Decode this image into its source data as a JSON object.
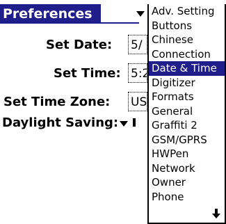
{
  "title": "Preferences",
  "fields": {
    "date": {
      "label": "Set Date:",
      "value": "5/"
    },
    "time": {
      "label": "Set Time:",
      "value": "5:2"
    },
    "timezone": {
      "label": "Set Time Zone:",
      "value": "US"
    },
    "dst": {
      "label": "Daylight Saving:"
    }
  },
  "menu": {
    "items": [
      "Adv. Setting",
      "Buttons",
      "Chinese",
      "Connection",
      "Date & Time",
      "Digitizer",
      "Formats",
      "General",
      "Graffiti 2",
      "GSM/GPRS",
      "HWPen",
      "Network",
      "Owner",
      "Phone"
    ],
    "selected_index": 4,
    "selected_color": "#1f1e8a"
  }
}
